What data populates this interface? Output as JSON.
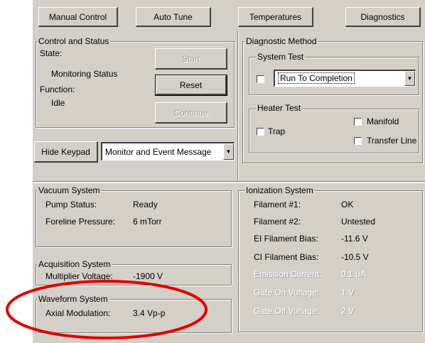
{
  "tabs": {
    "manual_control": "Manual Control",
    "auto_tune": "Auto Tune",
    "temperatures": "Temperatures",
    "diagnostics": "Diagnostics"
  },
  "control_status": {
    "title": "Control and Status",
    "state_label": "State:",
    "state_value": "Monitoring Status",
    "function_label": "Function:",
    "function_value": "Idle",
    "start_button": "Start",
    "reset_button": "Reset",
    "continue_button": "Continue"
  },
  "diagnostic_method": {
    "title": "Diagnostic Method",
    "system_test": {
      "title": "System Test",
      "selected": "Run To Completion"
    },
    "heater_test": {
      "title": "Heater Test",
      "trap": "Trap",
      "manifold": "Manifold",
      "transfer_line": "Transfer Line"
    }
  },
  "keypad": {
    "hide_button": "Hide Keypad",
    "message_select": "Monitor and Event Message"
  },
  "vacuum_system": {
    "title": "Vacuum System",
    "pump_status_label": "Pump Status:",
    "pump_status_value": "Ready",
    "foreline_label": "Foreline Pressure:",
    "foreline_value": "6 mTorr"
  },
  "acquisition_system": {
    "title": "Acquisition System",
    "multiplier_label": "Multiplier Voltage:",
    "multiplier_value": "-1900 V"
  },
  "waveform_system": {
    "title": "Waveform System",
    "axial_label": "Axial Modulation:",
    "axial_value": "3.4 Vp-p"
  },
  "ionization_system": {
    "title": "Ionization System",
    "rows": [
      {
        "label": "Filament #1:",
        "value": "OK",
        "enabled": true
      },
      {
        "label": "Filament #2:",
        "value": "Untested",
        "enabled": true
      },
      {
        "label": "EI Filament Bias:",
        "value": "-11.6 V",
        "enabled": true
      },
      {
        "label": "CI Filament Bias:",
        "value": "-10.5 V",
        "enabled": true
      },
      {
        "label": "Emission Current:",
        "value": "0.1 uA",
        "enabled": false
      },
      {
        "label": "Gate On Voltage:",
        "value": "1 V",
        "enabled": false
      },
      {
        "label": "Gate Off Voltage:",
        "value": "2 V",
        "enabled": false
      }
    ]
  },
  "highlight_color": "#e00000",
  "panel_color": "#d4d0c8"
}
